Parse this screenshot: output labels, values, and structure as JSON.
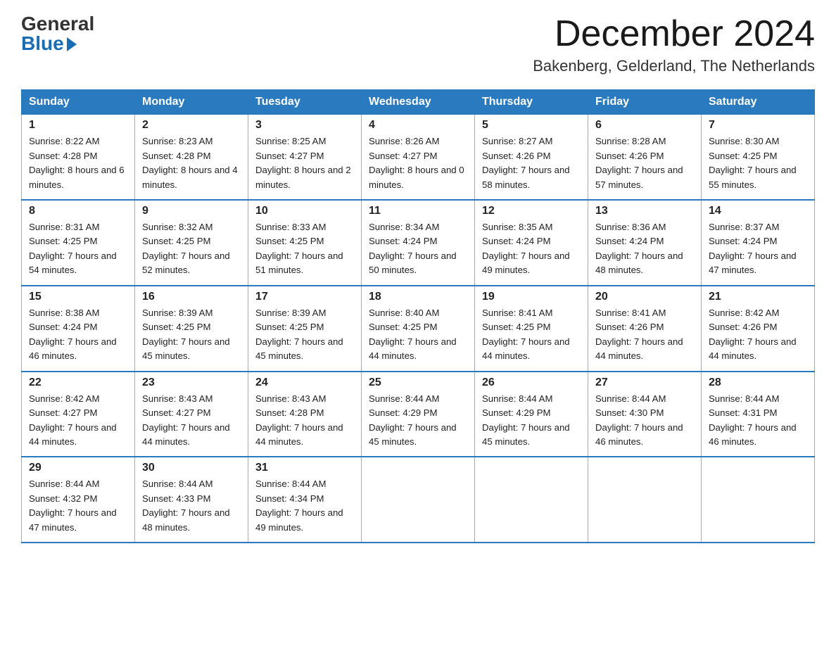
{
  "logo": {
    "general": "General",
    "blue": "Blue"
  },
  "title": "December 2024",
  "location": "Bakenberg, Gelderland, The Netherlands",
  "headers": [
    "Sunday",
    "Monday",
    "Tuesday",
    "Wednesday",
    "Thursday",
    "Friday",
    "Saturday"
  ],
  "weeks": [
    [
      {
        "day": "1",
        "sunrise": "8:22 AM",
        "sunset": "4:28 PM",
        "daylight": "8 hours and 6 minutes."
      },
      {
        "day": "2",
        "sunrise": "8:23 AM",
        "sunset": "4:28 PM",
        "daylight": "8 hours and 4 minutes."
      },
      {
        "day": "3",
        "sunrise": "8:25 AM",
        "sunset": "4:27 PM",
        "daylight": "8 hours and 2 minutes."
      },
      {
        "day": "4",
        "sunrise": "8:26 AM",
        "sunset": "4:27 PM",
        "daylight": "8 hours and 0 minutes."
      },
      {
        "day": "5",
        "sunrise": "8:27 AM",
        "sunset": "4:26 PM",
        "daylight": "7 hours and 58 minutes."
      },
      {
        "day": "6",
        "sunrise": "8:28 AM",
        "sunset": "4:26 PM",
        "daylight": "7 hours and 57 minutes."
      },
      {
        "day": "7",
        "sunrise": "8:30 AM",
        "sunset": "4:25 PM",
        "daylight": "7 hours and 55 minutes."
      }
    ],
    [
      {
        "day": "8",
        "sunrise": "8:31 AM",
        "sunset": "4:25 PM",
        "daylight": "7 hours and 54 minutes."
      },
      {
        "day": "9",
        "sunrise": "8:32 AM",
        "sunset": "4:25 PM",
        "daylight": "7 hours and 52 minutes."
      },
      {
        "day": "10",
        "sunrise": "8:33 AM",
        "sunset": "4:25 PM",
        "daylight": "7 hours and 51 minutes."
      },
      {
        "day": "11",
        "sunrise": "8:34 AM",
        "sunset": "4:24 PM",
        "daylight": "7 hours and 50 minutes."
      },
      {
        "day": "12",
        "sunrise": "8:35 AM",
        "sunset": "4:24 PM",
        "daylight": "7 hours and 49 minutes."
      },
      {
        "day": "13",
        "sunrise": "8:36 AM",
        "sunset": "4:24 PM",
        "daylight": "7 hours and 48 minutes."
      },
      {
        "day": "14",
        "sunrise": "8:37 AM",
        "sunset": "4:24 PM",
        "daylight": "7 hours and 47 minutes."
      }
    ],
    [
      {
        "day": "15",
        "sunrise": "8:38 AM",
        "sunset": "4:24 PM",
        "daylight": "7 hours and 46 minutes."
      },
      {
        "day": "16",
        "sunrise": "8:39 AM",
        "sunset": "4:25 PM",
        "daylight": "7 hours and 45 minutes."
      },
      {
        "day": "17",
        "sunrise": "8:39 AM",
        "sunset": "4:25 PM",
        "daylight": "7 hours and 45 minutes."
      },
      {
        "day": "18",
        "sunrise": "8:40 AM",
        "sunset": "4:25 PM",
        "daylight": "7 hours and 44 minutes."
      },
      {
        "day": "19",
        "sunrise": "8:41 AM",
        "sunset": "4:25 PM",
        "daylight": "7 hours and 44 minutes."
      },
      {
        "day": "20",
        "sunrise": "8:41 AM",
        "sunset": "4:26 PM",
        "daylight": "7 hours and 44 minutes."
      },
      {
        "day": "21",
        "sunrise": "8:42 AM",
        "sunset": "4:26 PM",
        "daylight": "7 hours and 44 minutes."
      }
    ],
    [
      {
        "day": "22",
        "sunrise": "8:42 AM",
        "sunset": "4:27 PM",
        "daylight": "7 hours and 44 minutes."
      },
      {
        "day": "23",
        "sunrise": "8:43 AM",
        "sunset": "4:27 PM",
        "daylight": "7 hours and 44 minutes."
      },
      {
        "day": "24",
        "sunrise": "8:43 AM",
        "sunset": "4:28 PM",
        "daylight": "7 hours and 44 minutes."
      },
      {
        "day": "25",
        "sunrise": "8:44 AM",
        "sunset": "4:29 PM",
        "daylight": "7 hours and 45 minutes."
      },
      {
        "day": "26",
        "sunrise": "8:44 AM",
        "sunset": "4:29 PM",
        "daylight": "7 hours and 45 minutes."
      },
      {
        "day": "27",
        "sunrise": "8:44 AM",
        "sunset": "4:30 PM",
        "daylight": "7 hours and 46 minutes."
      },
      {
        "day": "28",
        "sunrise": "8:44 AM",
        "sunset": "4:31 PM",
        "daylight": "7 hours and 46 minutes."
      }
    ],
    [
      {
        "day": "29",
        "sunrise": "8:44 AM",
        "sunset": "4:32 PM",
        "daylight": "7 hours and 47 minutes."
      },
      {
        "day": "30",
        "sunrise": "8:44 AM",
        "sunset": "4:33 PM",
        "daylight": "7 hours and 48 minutes."
      },
      {
        "day": "31",
        "sunrise": "8:44 AM",
        "sunset": "4:34 PM",
        "daylight": "7 hours and 49 minutes."
      },
      null,
      null,
      null,
      null
    ]
  ]
}
